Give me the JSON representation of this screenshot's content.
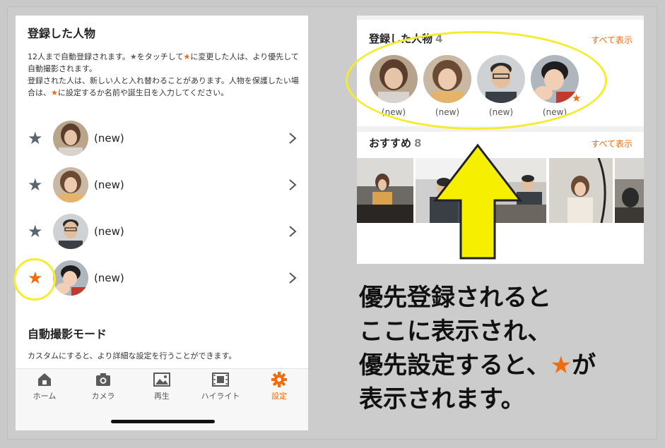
{
  "left_screen": {
    "title": "登録した人物",
    "desc_part1": "12人まで自動登録されます。",
    "desc_star_gray": "★",
    "desc_part2": "をタッチして",
    "desc_star_orange": "★",
    "desc_part3": "に変更した人は、より優先して自動撮影されます。",
    "desc_part4": "登録された人は、新しい人と入れ替わることがあります。人物を保護したい場合は、",
    "desc_star_orange2": "★",
    "desc_part5": "に設定するか名前や誕生日を入力してください。",
    "people": [
      {
        "label": "(new)",
        "star": "★",
        "starred": false
      },
      {
        "label": "(new)",
        "star": "★",
        "starred": false
      },
      {
        "label": "(new)",
        "star": "★",
        "starred": false
      },
      {
        "label": "(new)",
        "star": "★",
        "starred": true
      }
    ],
    "mode_title": "自動撮影モード",
    "mode_desc": "カスタムにすると、より詳細な設定を行うことができます。",
    "tabs": [
      {
        "label": "ホーム",
        "icon": "home-icon"
      },
      {
        "label": "カメラ",
        "icon": "camera-icon"
      },
      {
        "label": "再生",
        "icon": "image-icon"
      },
      {
        "label": "ハイライト",
        "icon": "film-icon"
      },
      {
        "label": "設定",
        "icon": "gear-icon"
      }
    ]
  },
  "right_screen": {
    "registered_title": "登録した人物",
    "registered_count": "4",
    "see_all_1": "すべて表示",
    "avatars": [
      {
        "label": "(new)"
      },
      {
        "label": "(new)"
      },
      {
        "label": "(new)"
      },
      {
        "label": "(new)"
      }
    ],
    "avatar_star": "★",
    "recommended_title": "おすすめ",
    "recommended_count": "8",
    "see_all_2": "すべて表示"
  },
  "caption": {
    "line1": "優先登録されると",
    "line2": "ここに表示され、",
    "line3a": "優先設定すると、",
    "line3_star": "★",
    "line3b": "が",
    "line4": "表示されます。"
  },
  "colors": {
    "accent": "#f26b0f",
    "highlight": "#f4ec2e",
    "gray_star": "#5c6470"
  }
}
